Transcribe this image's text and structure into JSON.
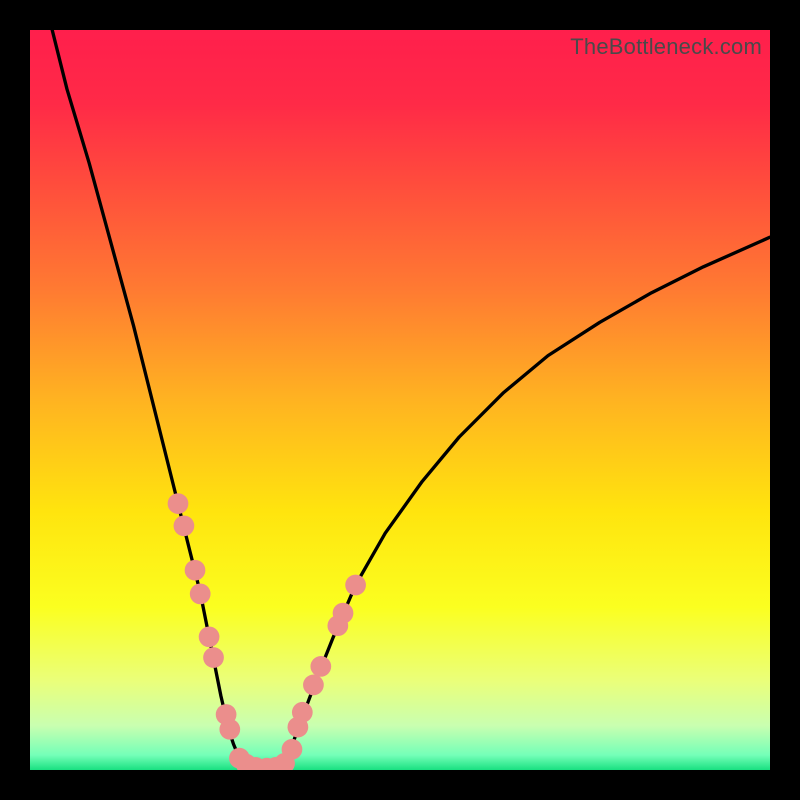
{
  "watermark": "TheBottleneck.com",
  "gradient": {
    "stops": [
      {
        "offset": 0.0,
        "color": "#ff1f4c"
      },
      {
        "offset": 0.1,
        "color": "#ff2a47"
      },
      {
        "offset": 0.2,
        "color": "#ff4a3d"
      },
      {
        "offset": 0.35,
        "color": "#ff7a32"
      },
      {
        "offset": 0.5,
        "color": "#ffb321"
      },
      {
        "offset": 0.65,
        "color": "#ffe40e"
      },
      {
        "offset": 0.78,
        "color": "#fbff20"
      },
      {
        "offset": 0.88,
        "color": "#eaff7a"
      },
      {
        "offset": 0.94,
        "color": "#c9ffb0"
      },
      {
        "offset": 0.98,
        "color": "#74ffb8"
      },
      {
        "offset": 1.0,
        "color": "#19e081"
      }
    ]
  },
  "chart_data": {
    "type": "line",
    "title": "",
    "xlabel": "",
    "ylabel": "",
    "xlim": [
      0,
      100
    ],
    "ylim": [
      0,
      100
    ],
    "grid": false,
    "series": [
      {
        "name": "left-curve",
        "x": [
          3,
          5,
          8,
          11,
          14,
          16,
          18,
          20,
          21.5,
          23,
          24,
          25,
          25.8,
          26.5,
          27,
          27.5,
          28,
          29,
          30
        ],
        "y": [
          100,
          92,
          82,
          71,
          60,
          52,
          44,
          36,
          30,
          24,
          19,
          14,
          10,
          7,
          5,
          3.5,
          2.3,
          1,
          0.4
        ]
      },
      {
        "name": "valley-floor",
        "x": [
          30,
          31,
          32,
          33,
          34
        ],
        "y": [
          0.4,
          0.2,
          0.2,
          0.25,
          0.45
        ]
      },
      {
        "name": "right-curve",
        "x": [
          34,
          35,
          36,
          37.5,
          39,
          41,
          44,
          48,
          53,
          58,
          64,
          70,
          77,
          84,
          91,
          100
        ],
        "y": [
          0.45,
          2,
          5,
          9,
          13,
          18,
          25,
          32,
          39,
          45,
          51,
          56,
          60.5,
          64.5,
          68,
          72
        ]
      }
    ],
    "markers": {
      "name": "highlighted-points",
      "color": "#eb8e8c",
      "radius": 1.4,
      "points": [
        {
          "x": 20.0,
          "y": 36.0
        },
        {
          "x": 20.8,
          "y": 33.0
        },
        {
          "x": 22.3,
          "y": 27.0
        },
        {
          "x": 23.0,
          "y": 23.8
        },
        {
          "x": 24.2,
          "y": 18.0
        },
        {
          "x": 24.8,
          "y": 15.2
        },
        {
          "x": 26.5,
          "y": 7.5
        },
        {
          "x": 27.0,
          "y": 5.5
        },
        {
          "x": 28.3,
          "y": 1.6
        },
        {
          "x": 29.2,
          "y": 0.8
        },
        {
          "x": 30.5,
          "y": 0.35
        },
        {
          "x": 32.0,
          "y": 0.25
        },
        {
          "x": 33.2,
          "y": 0.35
        },
        {
          "x": 34.4,
          "y": 0.9
        },
        {
          "x": 35.4,
          "y": 2.8
        },
        {
          "x": 36.2,
          "y": 5.8
        },
        {
          "x": 36.8,
          "y": 7.8
        },
        {
          "x": 38.3,
          "y": 11.5
        },
        {
          "x": 39.3,
          "y": 14.0
        },
        {
          "x": 41.6,
          "y": 19.5
        },
        {
          "x": 42.3,
          "y": 21.2
        },
        {
          "x": 44.0,
          "y": 25.0
        }
      ]
    }
  }
}
